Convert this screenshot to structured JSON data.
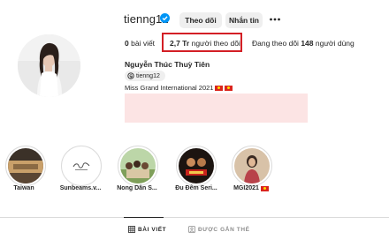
{
  "header": {
    "username": "tienng12",
    "follow_button": "Theo dõi",
    "message_button": "Nhắn tin"
  },
  "stats": {
    "posts_count": "0",
    "posts_label": "bài viết",
    "followers_count": "2,7 Tr",
    "followers_label": "người theo dõi",
    "following_prefix": "Đang theo dõi",
    "following_count": "148",
    "following_suffix": "người dùng"
  },
  "bio": {
    "full_name": "Nguyễn Thúc Thuỳ Tiên",
    "threads_handle": "tienng12",
    "text": "Miss Grand International 2021"
  },
  "highlights": [
    {
      "label": "Taiwan"
    },
    {
      "label": "Sunbeams.v..."
    },
    {
      "label": "Nong Dân S..."
    },
    {
      "label": "Đu Đêm Seri..."
    },
    {
      "label": "MGI2021"
    }
  ],
  "tabs": {
    "posts": "BÀI VIẾT",
    "tagged": "ĐƯỢC GẮN THẺ"
  },
  "colors": {
    "highlight_box": "#d31f25",
    "verified": "#0095f6",
    "pink_block": "#fce4e4"
  }
}
